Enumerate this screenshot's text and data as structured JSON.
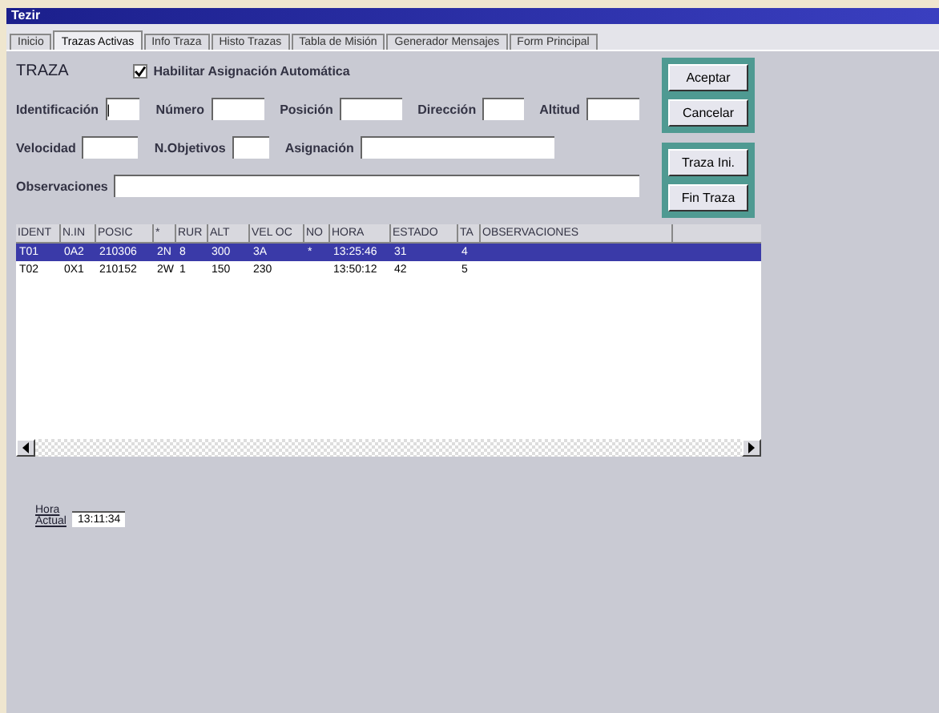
{
  "window": {
    "title": "Tezir"
  },
  "tabs": [
    {
      "label": "Inicio",
      "selected": false
    },
    {
      "label": "Trazas Activas",
      "selected": true
    },
    {
      "label": "Info Traza",
      "selected": false
    },
    {
      "label": "Histo Trazas",
      "selected": false
    },
    {
      "label": "Tabla de Misión",
      "selected": false
    },
    {
      "label": "Generador Mensajes",
      "selected": false
    },
    {
      "label": "Form Principal",
      "selected": false
    }
  ],
  "form": {
    "heading": "TRAZA",
    "auto_assign": {
      "label": "Habilitar Asignación Automática",
      "checked": true
    },
    "rows": [
      [
        {
          "label": "Identificación",
          "value": "|"
        },
        {
          "label": "Número"
        },
        {
          "label": "Posición"
        },
        {
          "label": "Dirección"
        },
        {
          "label": "Altitud"
        }
      ],
      [
        {
          "label": "Velocidad"
        },
        {
          "label": "N.Objetivos"
        },
        {
          "label": "Asignación"
        }
      ],
      [
        {
          "label": "Observaciones"
        }
      ]
    ]
  },
  "buttons": [
    [
      "Aceptar",
      "Cancelar"
    ],
    [
      "Traza Ini.",
      "Fin Traza"
    ]
  ],
  "table": {
    "columns": [
      "IDENT",
      "N.IN",
      "POSIC",
      "*",
      "RUR",
      "ALT",
      "VEL OC",
      "NO",
      "HORA",
      "ESTADO",
      "TA",
      "OBSERVACIONES"
    ],
    "rows": [
      {
        "selected": true,
        "cells": [
          "T01",
          "0A2",
          "210306",
          "2N",
          "8",
          "300",
          "3A",
          "*",
          "13:25:46",
          "31",
          "4",
          null
        ]
      },
      {
        "selected": false,
        "cells": [
          "T02",
          "0X1",
          "210152",
          "2W",
          "1",
          "150",
          "230",
          null,
          "13:50:12",
          "42",
          "5",
          null
        ]
      }
    ]
  },
  "clock": {
    "label_line_1": "Hora",
    "label_line_2": "Actual",
    "value": "13:11:34"
  }
}
